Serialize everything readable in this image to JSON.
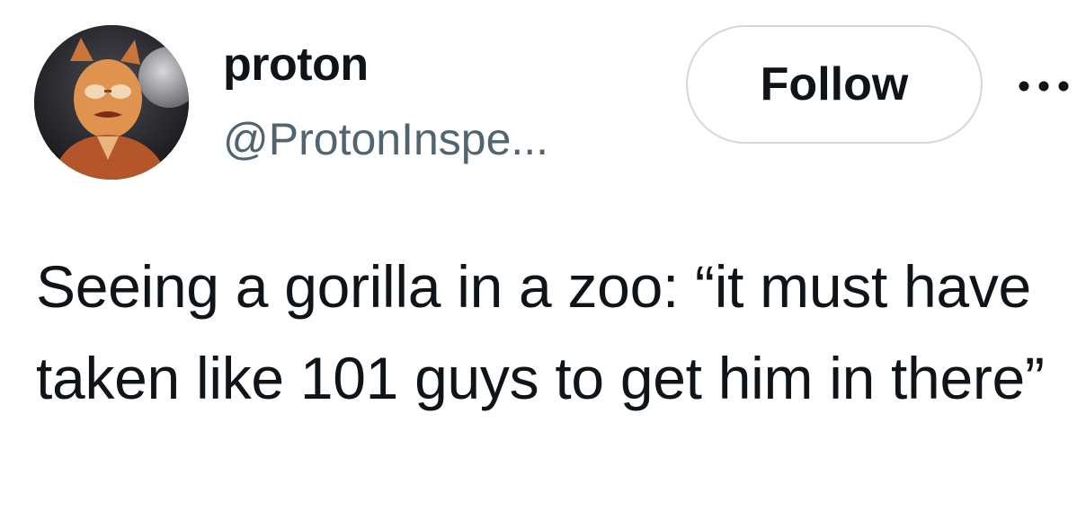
{
  "author": {
    "display_name": "proton",
    "handle": "@ProtonInspe..."
  },
  "actions": {
    "follow_label": "Follow",
    "more_icon": "more-horizontal-icon"
  },
  "tweet": {
    "text": "Seeing a gorilla in a zoo: “it must have taken like 101 guys to get him in there”"
  },
  "colors": {
    "text_primary": "#0f1419",
    "text_secondary": "#536471",
    "button_border": "#cfd9de"
  }
}
